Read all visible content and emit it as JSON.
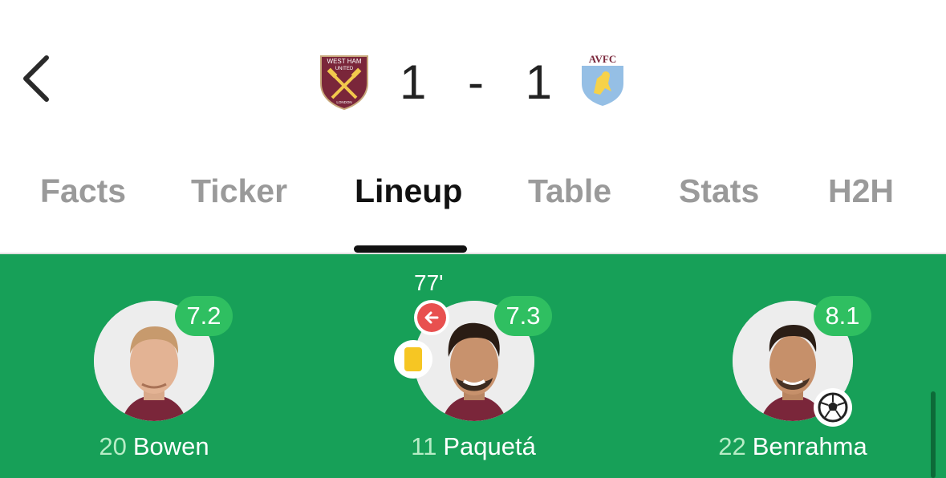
{
  "header": {
    "home_crest": "west-ham-crest",
    "home_crest_lines": [
      "WEST HAM",
      "UNITED",
      "LONDON"
    ],
    "away_crest": "aston-villa-crest",
    "away_crest_text": "AVFC",
    "score": {
      "home": "1",
      "separator": "-",
      "away": "1"
    }
  },
  "tabs": [
    {
      "label": "Facts",
      "active": false
    },
    {
      "label": "Ticker",
      "active": false
    },
    {
      "label": "Lineup",
      "active": true
    },
    {
      "label": "Table",
      "active": false
    },
    {
      "label": "Stats",
      "active": false
    },
    {
      "label": "H2H",
      "active": false
    }
  ],
  "players": [
    {
      "number": "20",
      "name": "Bowen",
      "rating": "7.2"
    },
    {
      "number": "11",
      "name": "Paquetá",
      "rating": "7.3",
      "sub_time": "77'",
      "yellow_card": true,
      "subbed_off": true
    },
    {
      "number": "22",
      "name": "Benrahma",
      "rating": "8.1",
      "goal": true
    }
  ],
  "colors": {
    "pitch": "#17a058",
    "rating_badge": "#2fbf61",
    "home_crest": "#7a263a",
    "away_crest": "#95bfe5",
    "sub_icon": "#e8504f",
    "yellow_card": "#f6c623"
  }
}
